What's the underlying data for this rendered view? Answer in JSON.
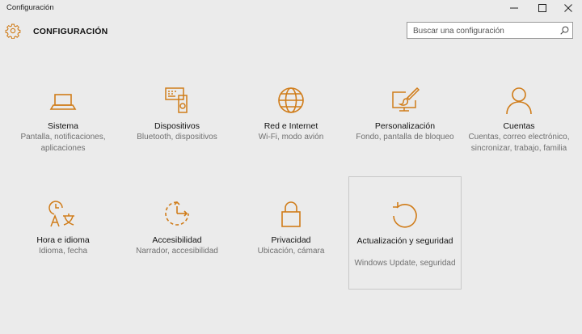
{
  "window": {
    "title": "Configuración",
    "minimize_icon": "minimize-icon",
    "maximize_icon": "maximize-icon",
    "close_icon": "close-icon"
  },
  "header": {
    "title": "CONFIGURACIÓN",
    "icon": "gear-icon"
  },
  "search": {
    "placeholder": "Buscar una configuración",
    "value": ""
  },
  "accent_color": "#d07c19",
  "tiles": [
    {
      "id": "sistema",
      "label": "Sistema",
      "desc": "Pantalla, notificaciones, aplicaciones",
      "icon": "laptop-icon"
    },
    {
      "id": "dispositivos",
      "label": "Dispositivos",
      "desc": "Bluetooth, dispositivos",
      "icon": "devices-icon"
    },
    {
      "id": "red",
      "label": "Red e Internet",
      "desc": "Wi-Fi, modo avión",
      "icon": "globe-icon"
    },
    {
      "id": "personalizacion",
      "label": "Personalización",
      "desc": "Fondo, pantalla de bloqueo",
      "icon": "paint-icon"
    },
    {
      "id": "cuentas",
      "label": "Cuentas",
      "desc": "Cuentas, correo electrónico, sincronizar, trabajo, familia",
      "icon": "person-icon"
    },
    {
      "id": "hora",
      "label": "Hora e idioma",
      "desc": "Idioma, fecha",
      "icon": "time-language-icon"
    },
    {
      "id": "accesibilidad",
      "label": "Accesibilidad",
      "desc": "Narrador, accesibilidad",
      "icon": "accessibility-icon"
    },
    {
      "id": "privacidad",
      "label": "Privacidad",
      "desc": "Ubicación, cámara",
      "icon": "lock-icon"
    },
    {
      "id": "actualizacion",
      "label": "Actualización y seguridad",
      "desc": "Windows Update, seguridad",
      "icon": "update-icon"
    }
  ]
}
